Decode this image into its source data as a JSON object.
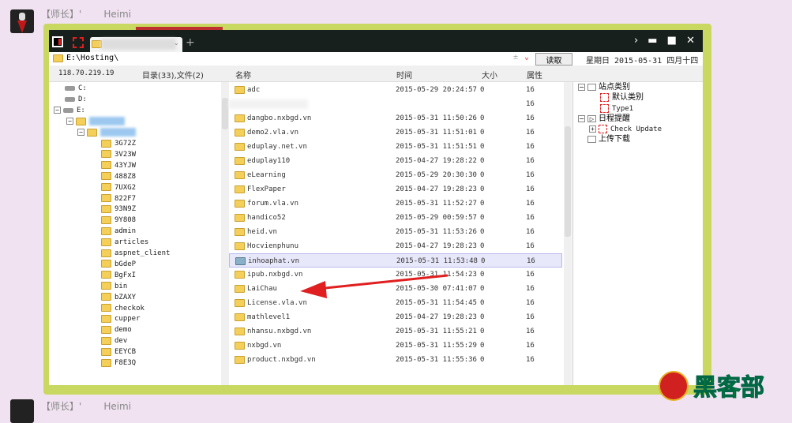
{
  "post": {
    "user_prefix": "【师长】'",
    "user_name": "Heimi",
    "next_prefix": "【师长】'",
    "next_name": "Heimi"
  },
  "window": {
    "tab_label": "",
    "new_tab": "+",
    "controls": "› ▬ ■ ✕"
  },
  "address": {
    "path": "E:\\Hosting\\",
    "read_button": "读取",
    "date": "星期日 2015-05-31 四月十四"
  },
  "header": {
    "ip": "118.70.219.19",
    "summary": "目录(33),文件(2)",
    "col_name": "名称",
    "col_time": "时间",
    "col_size": "大小",
    "col_attr": "属性"
  },
  "tree": {
    "drives": [
      "C:",
      "D:",
      "E:"
    ],
    "folders": [
      "3G72Z",
      "3V23W",
      "43YJW",
      "488Z8",
      "7UXG2",
      "822F7",
      "93N9Z",
      "9Y808",
      "admin",
      "articles",
      "aspnet_client",
      "bGdeP",
      "BgFxI",
      "bin",
      "bZAXY",
      "checkok",
      "cupper",
      "demo",
      "dev",
      "EEYCB",
      "F8E3Q"
    ]
  },
  "files": [
    {
      "name": "adc",
      "time": "2015-05-29 20:24:57",
      "size": "0",
      "attr": "16"
    },
    {
      "name": "",
      "time": "",
      "size": "",
      "attr": "16"
    },
    {
      "name": "dangbo.nxbgd.vn",
      "time": "2015-05-31 11:50:26",
      "size": "0",
      "attr": "16"
    },
    {
      "name": "demo2.vla.vn",
      "time": "2015-05-31 11:51:01",
      "size": "0",
      "attr": "16"
    },
    {
      "name": "eduplay.net.vn",
      "time": "2015-05-31 11:51:51",
      "size": "0",
      "attr": "16"
    },
    {
      "name": "eduplay110",
      "time": "2015-04-27 19:28:22",
      "size": "0",
      "attr": "16"
    },
    {
      "name": "eLearning",
      "time": "2015-05-29 20:30:30",
      "size": "0",
      "attr": "16"
    },
    {
      "name": "FlexPaper",
      "time": "2015-04-27 19:28:23",
      "size": "0",
      "attr": "16"
    },
    {
      "name": "forum.vla.vn",
      "time": "2015-05-31 11:52:27",
      "size": "0",
      "attr": "16"
    },
    {
      "name": "handico52",
      "time": "2015-05-29 00:59:57",
      "size": "0",
      "attr": "16"
    },
    {
      "name": "heid.vn",
      "time": "2015-05-31 11:53:26",
      "size": "0",
      "attr": "16"
    },
    {
      "name": "Hocvienphunu",
      "time": "2015-04-27 19:28:23",
      "size": "0",
      "attr": "16"
    },
    {
      "name": "inhoaphat.vn",
      "time": "2015-05-31 11:53:48",
      "size": "0",
      "attr": "16",
      "selected": true
    },
    {
      "name": "ipub.nxbgd.vn",
      "time": "2015-05-31 11:54:23",
      "size": "0",
      "attr": "16"
    },
    {
      "name": "LaiChau",
      "time": "2015-05-30 07:41:07",
      "size": "0",
      "attr": "16"
    },
    {
      "name": "License.vla.vn",
      "time": "2015-05-31 11:54:45",
      "size": "0",
      "attr": "16"
    },
    {
      "name": "mathlevel1",
      "time": "2015-04-27 19:28:23",
      "size": "0",
      "attr": "16"
    },
    {
      "name": "nhansu.nxbgd.vn",
      "time": "2015-05-31 11:55:21",
      "size": "0",
      "attr": "16"
    },
    {
      "name": "nxbgd.vn",
      "time": "2015-05-31 11:55:29",
      "size": "0",
      "attr": "16"
    },
    {
      "name": "product.nxbgd.vn",
      "time": "2015-05-31 11:55:36",
      "size": "0",
      "attr": "16"
    }
  ],
  "right_panel": {
    "site_category": "站点类别",
    "default_category": "默认类别",
    "type1": "Type1",
    "schedule": "日程提醒",
    "check_update": "Check Update",
    "upload_download": "上传下载"
  },
  "watermark": "黑客部",
  "colors": {
    "frame": "#c8d860",
    "arrow": "#e02020",
    "selection": "#e8e8fb"
  }
}
